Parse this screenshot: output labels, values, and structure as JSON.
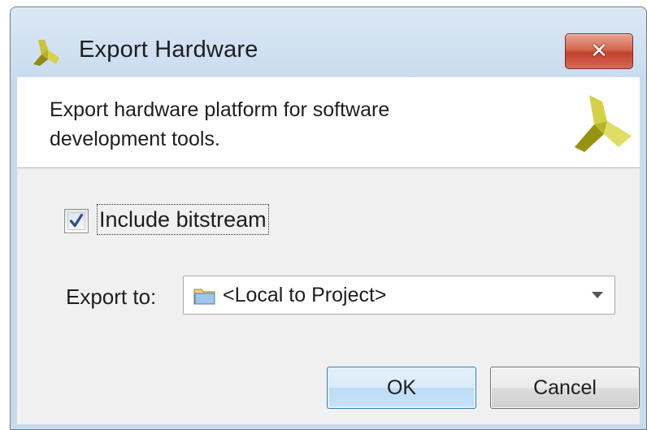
{
  "window": {
    "title": "Export Hardware",
    "app_icon": "xilinx-vivado-logo",
    "close_icon": "close-x-icon",
    "close_glyph": "✕"
  },
  "header": {
    "description": "Export hardware platform for software development tools.",
    "logo_icon": "xilinx-vivado-logo"
  },
  "options": {
    "include_bitstream": {
      "label": "Include bitstream",
      "checked": true
    },
    "export_to": {
      "label": "Export to:",
      "value": "<Local to Project>",
      "icon": "folder-icon"
    }
  },
  "buttons": {
    "ok_label": "OK",
    "cancel_label": "Cancel"
  },
  "colors": {
    "titlebar": "#c9dcef",
    "client_bg": "#f0f0f0",
    "close_button": "#c2412b",
    "ok_button_border": "#3c7fb1",
    "logo_dark": "#9a9a16",
    "logo_light": "#d2d24a"
  }
}
